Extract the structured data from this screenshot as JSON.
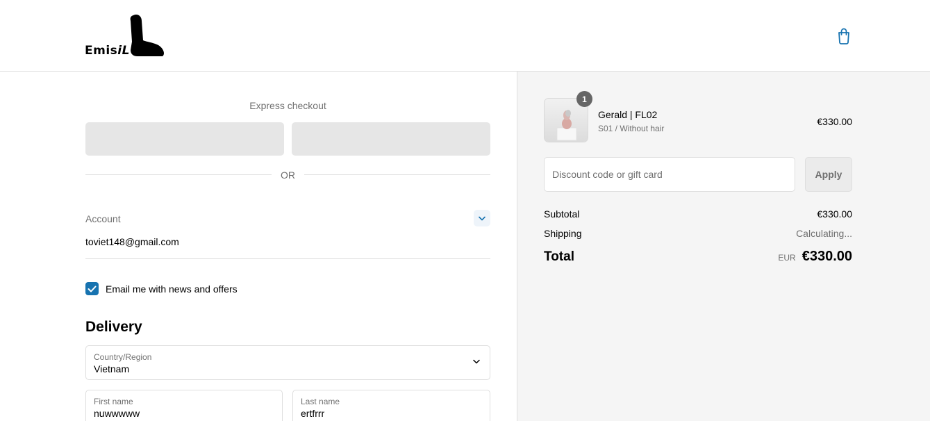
{
  "brand": {
    "logo_text_a": "Emis",
    "logo_text_b": "iL"
  },
  "header": {
    "cart_icon": "shopping-bag-icon",
    "accent_color": "#1773b0"
  },
  "express_checkout": {
    "title": "Express checkout",
    "separator": "OR"
  },
  "account": {
    "label": "Account",
    "email": "toviet148@gmail.com",
    "toggle_icon": "chevron-down-icon"
  },
  "newsletter": {
    "label": "Email me with news and offers",
    "checked": true
  },
  "delivery": {
    "title": "Delivery",
    "country": {
      "label": "Country/Region",
      "value": "Vietnam"
    },
    "first_name": {
      "label": "First name",
      "value": "nuwwwww"
    },
    "last_name": {
      "label": "Last name",
      "value": "ertfrrr"
    }
  },
  "order_summary": {
    "item": {
      "quantity": "1",
      "name": "Gerald | FL02",
      "variant": "S01 / Without hair",
      "price": "€330.00"
    },
    "discount": {
      "placeholder": "Discount code or gift card",
      "apply_label": "Apply"
    },
    "subtotal": {
      "label": "Subtotal",
      "value": "€330.00"
    },
    "shipping": {
      "label": "Shipping",
      "value": "Calculating..."
    },
    "total": {
      "label": "Total",
      "currency": "EUR",
      "value": "€330.00"
    }
  }
}
